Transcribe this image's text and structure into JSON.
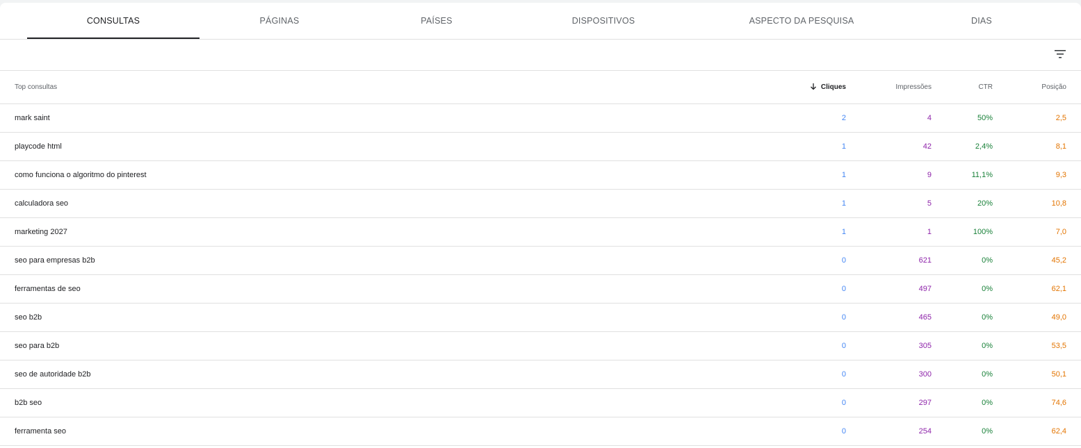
{
  "tabs": [
    {
      "label": "CONSULTAS",
      "active": true
    },
    {
      "label": "PÁGINAS",
      "active": false
    },
    {
      "label": "PAÍSES",
      "active": false
    },
    {
      "label": "DISPOSITIVOS",
      "active": false
    },
    {
      "label": "ASPECTO DA PESQUISA",
      "active": false
    },
    {
      "label": "DIAS",
      "active": false
    }
  ],
  "toolbar": {
    "filter_icon": "filter-list-icon"
  },
  "table": {
    "headers": {
      "query": "Top consultas",
      "clicks": "Cliques",
      "impressions": "Impressões",
      "ctr": "CTR",
      "position": "Posição"
    },
    "sorted_by": "clicks",
    "sort_direction": "descending",
    "colors": {
      "clicks": "#4285f4",
      "impressions": "#8e24aa",
      "ctr": "#188038",
      "position": "#e37400"
    },
    "rows": [
      {
        "query": "mark saint",
        "clicks": "2",
        "impressions": "4",
        "ctr": "50%",
        "position": "2,5"
      },
      {
        "query": "playcode html",
        "clicks": "1",
        "impressions": "42",
        "ctr": "2,4%",
        "position": "8,1"
      },
      {
        "query": "como funciona o algoritmo do pinterest",
        "clicks": "1",
        "impressions": "9",
        "ctr": "11,1%",
        "position": "9,3"
      },
      {
        "query": "calculadora seo",
        "clicks": "1",
        "impressions": "5",
        "ctr": "20%",
        "position": "10,8"
      },
      {
        "query": "marketing 2027",
        "clicks": "1",
        "impressions": "1",
        "ctr": "100%",
        "position": "7,0"
      },
      {
        "query": "seo para empresas b2b",
        "clicks": "0",
        "impressions": "621",
        "ctr": "0%",
        "position": "45,2"
      },
      {
        "query": "ferramentas de seo",
        "clicks": "0",
        "impressions": "497",
        "ctr": "0%",
        "position": "62,1"
      },
      {
        "query": "seo b2b",
        "clicks": "0",
        "impressions": "465",
        "ctr": "0%",
        "position": "49,0"
      },
      {
        "query": "seo para b2b",
        "clicks": "0",
        "impressions": "305",
        "ctr": "0%",
        "position": "53,5"
      },
      {
        "query": "seo de autoridade b2b",
        "clicks": "0",
        "impressions": "300",
        "ctr": "0%",
        "position": "50,1"
      },
      {
        "query": "b2b seo",
        "clicks": "0",
        "impressions": "297",
        "ctr": "0%",
        "position": "74,6"
      },
      {
        "query": "ferramenta seo",
        "clicks": "0",
        "impressions": "254",
        "ctr": "0%",
        "position": "62,4"
      }
    ]
  }
}
